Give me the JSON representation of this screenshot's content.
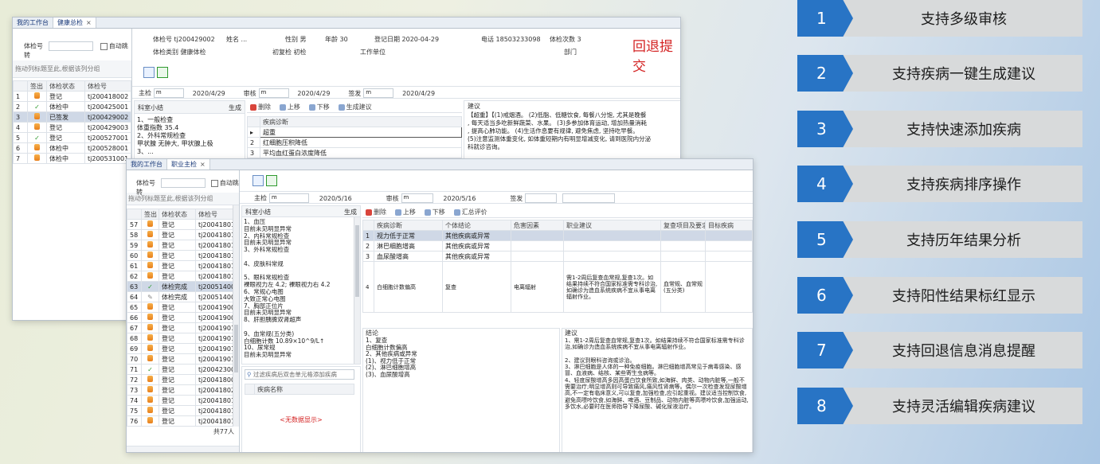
{
  "features": [
    {
      "num": "1",
      "label": "支持多级审核"
    },
    {
      "num": "2",
      "label": "支持疾病一键生成建议"
    },
    {
      "num": "3",
      "label": "支持快速添加疾病"
    },
    {
      "num": "4",
      "label": "支持疾病排序操作"
    },
    {
      "num": "5",
      "label": "支持历年结果分析"
    },
    {
      "num": "6",
      "label": "支持阳性结果标红显示"
    },
    {
      "num": "7",
      "label": "支持回退信息消息提醒"
    },
    {
      "num": "8",
      "label": "支持灵活编辑疾病建议"
    }
  ],
  "back": {
    "tabs": [
      "我的工作台",
      "健康总检"
    ],
    "exam_no_label": "体检号",
    "auto_jump": "自动跳转",
    "drag_hint": "拖动列标题至此,根据该列分组",
    "cols": [
      "",
      "签出",
      "体检状态",
      "体检号"
    ],
    "rows": [
      {
        "n": "1",
        "icon": "cyl",
        "status": "登记",
        "id": "tj200418002"
      },
      {
        "n": "2",
        "icon": "chk",
        "status": "体检中",
        "id": "tj200425001"
      },
      {
        "n": "3",
        "icon": "cyl",
        "status": "已签发",
        "id": "tj200429002",
        "sel": true
      },
      {
        "n": "4",
        "icon": "cyl",
        "status": "登记",
        "id": "tj200429003"
      },
      {
        "n": "5",
        "icon": "chk",
        "status": "登记",
        "id": "tj200527001"
      },
      {
        "n": "6",
        "icon": "cyl",
        "status": "体检中",
        "id": "tj200528001"
      },
      {
        "n": "7",
        "icon": "cyl",
        "status": "体检中",
        "id": "tj200531001"
      }
    ],
    "info": {
      "l1": "体检号 tj200429002",
      "l2": "姓名 ...",
      "l3": "性别 男",
      "l4": "年龄 30",
      "l5": "登记日期 2020-04-29",
      "l6": "电话 18503233098",
      "l7": "体检次数 3",
      "l8": "体检类别 健康体检",
      "l9": "初复检 初检",
      "l10": "工作单位",
      "l11": "部门"
    },
    "returned": "回退提交",
    "main_label": "主检",
    "main_val": "m",
    "date1": "2020/4/29",
    "review_label": "审核",
    "review_val": "m",
    "date2": "2020/4/29",
    "sign_label": "签发",
    "sign_val": "m",
    "date3": "2020/4/29",
    "summary_title": "科室小结",
    "generate": "生成",
    "summary_text": "1、一般检查\n体重指数 35.4\n2、外科常规检查\n甲状腺 无肿大, 甲状腺上极\n3、...",
    "toolbar": [
      "删除",
      "上移",
      "下移",
      "生成建议"
    ],
    "disease_col": "疾病诊断",
    "diseases": [
      "超重",
      "红细胞压积降低",
      "平均血红蛋白浓度降低"
    ],
    "advice_title": "建议",
    "advice_text": "【超重】【(1)戒烟酒。 (2)低脂、低糖饮食, 每餐八分饱, 尤其是晚餐\n, 每天适当多吃新鲜蔬菜、水果。 (3)多参加体育运动, 增加热量消耗\n, 提高心肺功能。 (4)生活作息要有规律, 避免焦虑, 坚持吃早餐。\n(5)注意监测体重变化, 如体重短期内有明显增减变化, 请到医院内分泌\n科就诊咨询。\n\n【红细胞压积降低】【结合临床, 内科诊治。"
  },
  "front": {
    "tabs": [
      "我的工作台",
      "职业主检"
    ],
    "exam_no_label": "体检号",
    "auto_jump": "自动跳转",
    "drag_hint": "拖动列标题至此,根据该列分组",
    "cols": [
      "",
      "签出",
      "体检状态",
      "体检号"
    ],
    "rows": [
      {
        "n": "57",
        "icon": "cyl",
        "status": "登记",
        "id": "tj200418010"
      },
      {
        "n": "58",
        "icon": "cyl",
        "status": "登记",
        "id": "tj200418011"
      },
      {
        "n": "59",
        "icon": "cyl",
        "status": "登记",
        "id": "tj200418012"
      },
      {
        "n": "60",
        "icon": "cyl",
        "status": "登记",
        "id": "tj200418014"
      },
      {
        "n": "61",
        "icon": "cyl",
        "status": "登记",
        "id": "tj200418015"
      },
      {
        "n": "62",
        "icon": "cyl",
        "status": "登记",
        "id": "tj200418016"
      },
      {
        "n": "63",
        "icon": "chk",
        "status": "体检完成",
        "id": "tj200514001",
        "sel": true
      },
      {
        "n": "64",
        "icon": "pen",
        "status": "体检完成",
        "id": "tj200514002"
      },
      {
        "n": "65",
        "icon": "cyl",
        "status": "登记",
        "id": "tj200419005"
      },
      {
        "n": "66",
        "icon": "cyl",
        "status": "登记",
        "id": "tj200419006"
      },
      {
        "n": "67",
        "icon": "cyl",
        "status": "登记",
        "id": "tj200419011"
      },
      {
        "n": "68",
        "icon": "cyl",
        "status": "登记",
        "id": "tj200419012"
      },
      {
        "n": "69",
        "icon": "cyl",
        "status": "登记",
        "id": "tj200419013"
      },
      {
        "n": "70",
        "icon": "cyl",
        "status": "登记",
        "id": "tj200419014"
      },
      {
        "n": "71",
        "icon": "chk",
        "status": "登记",
        "id": "tj200423001"
      },
      {
        "n": "72",
        "icon": "cyl",
        "status": "登记",
        "id": "tj200418003"
      },
      {
        "n": "73",
        "icon": "cyl",
        "status": "登记",
        "id": "tj200418020"
      },
      {
        "n": "74",
        "icon": "cyl",
        "status": "登记",
        "id": "tj200418017"
      },
      {
        "n": "75",
        "icon": "cyl",
        "status": "登记",
        "id": "tj200418019"
      },
      {
        "n": "76",
        "icon": "cyl",
        "status": "登记",
        "id": "tj200418018"
      },
      {
        "n": "77",
        "icon": "cyl",
        "status": "登记",
        "id": "tj200418013"
      }
    ],
    "total": "共77人",
    "main_label": "主检",
    "main_val": "m",
    "date1": "2020/5/16",
    "review_label": "审核",
    "review_val": "m",
    "date2": "2020/5/16",
    "sign_label": "签发",
    "summary_title": "科室小结",
    "generate": "生成",
    "summary_text": "1、血压\n目前未见明显异常\n2、内科常规检查\n目前未见明显异常\n3、外科常规检查\n\n4、皮肤科常规\n\n5、眼科常规检查\n裸眼视力左 4.2; 裸眼视力右 4.2\n6、常规心电图\n大致正常心电图\n7、胸部正位片\n目前未见明显异常\n8、肝胆胰脾双肾超声\n\n9、血常规(五分类)\n白细胞计数 10.89×10^9/L↑\n10、尿常规\n目前未见明显异常",
    "filter_placeholder": "过滤疾病后双击单元格添加疾病",
    "disease_name_col": "疾病名称",
    "no_data": "<无数据显示>",
    "toolbar": [
      "删除",
      "上移",
      "下移",
      "汇总评价"
    ],
    "grid_cols": [
      "",
      "疾病诊断",
      "个体结论",
      "危害因素",
      "职业建议",
      "复查项目及要求",
      "目标疾病"
    ],
    "grid_rows": [
      {
        "n": "1",
        "diag": "视力低于正常",
        "concl": "其他疾病或异常",
        "risk": "",
        "advice": "",
        "recheck": "",
        "target": ""
      },
      {
        "n": "2",
        "diag": "淋巴细胞增高",
        "concl": "其他疾病或异常",
        "risk": "",
        "advice": "",
        "recheck": "",
        "target": ""
      },
      {
        "n": "3",
        "diag": "血尿酸增高",
        "concl": "其他疾病或异常",
        "risk": "",
        "advice": "",
        "recheck": "",
        "target": ""
      },
      {
        "n": "4",
        "diag": "白细胞计数偏高",
        "concl": "复查",
        "risk": "电离辐射",
        "advice": "需1-2周后复查血常规,复查1次。如结果持续不符合国家标准需专科诊治,如确诊为造血系统疾病不宜从事电离辐射作业。",
        "recheck": "血常规、血常规(五分类)",
        "target": ""
      }
    ],
    "conclusion_title": "结论",
    "conclusion_text": "1、复查\n白细胞计数偏高\n2、其他疾病或异常\n(1)、视力低于正常\n(2)、淋巴细胞增高\n(3)、血尿酸增高",
    "advice_title": "建议",
    "advice_text": "1、需1-2周后复查血常规,复查1次。如结果持续不符合国家标准需专科诊治,如确诊为造血系统疾病不宜从事电离辐射作业。\n\n2、建议到眼科咨询或诊治。\n3、淋巴细胞是人体的一种免疫细胞。淋巴细胞增高常见于病毒感染、感冒、血液病、结核、某些寄生虫病等。\n4、轻度尿酸增高多因高蛋白饮食所致,如海鲜、肉类、动物内脏等,一般不需要治疗;明显增高则可导致痛风,痛风性肾病等。偶尔一次检查发现尿酸增高,不一定有临床意义,可以复查,加强检查,应引起重视。建议适当控制饮食,避免高嘌呤饮食,如海鲜、啤酒、豆制品、动物内脏等高嘌呤饮食,加强运动,多饮水,必要时在医师指导下降尿酸、碱化尿液治疗。"
  }
}
